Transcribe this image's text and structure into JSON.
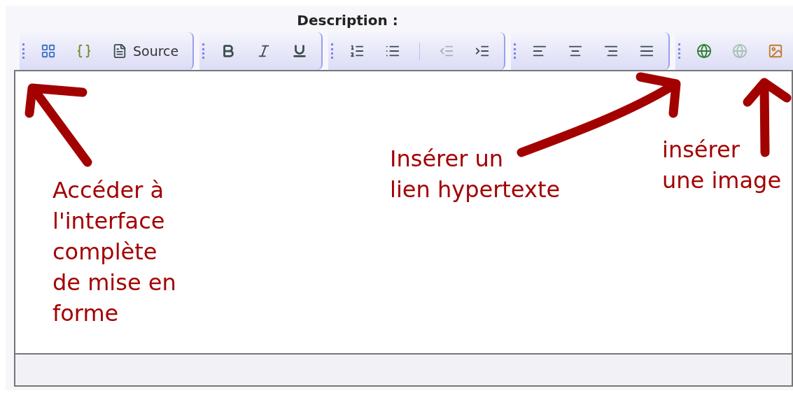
{
  "field_label": "Description :",
  "toolbar": [
    {
      "buttons": [
        {
          "kind": "maximize",
          "disabled": false
        },
        {
          "kind": "templates",
          "disabled": false
        },
        {
          "kind": "source",
          "label": "Source",
          "disabled": false
        }
      ]
    },
    {
      "buttons": [
        {
          "kind": "bold",
          "disabled": false
        },
        {
          "kind": "italic",
          "disabled": false
        },
        {
          "kind": "underline",
          "disabled": false
        }
      ]
    },
    {
      "buttons": [
        {
          "kind": "ordered-list",
          "disabled": false
        },
        {
          "kind": "bullet-list",
          "disabled": false
        },
        {
          "kind": "separator"
        },
        {
          "kind": "outdent",
          "disabled": true
        },
        {
          "kind": "indent",
          "disabled": false
        }
      ]
    },
    {
      "buttons": [
        {
          "kind": "align-left",
          "disabled": false
        },
        {
          "kind": "align-center",
          "disabled": false
        },
        {
          "kind": "align-right",
          "disabled": false
        },
        {
          "kind": "align-justify",
          "disabled": false
        }
      ]
    },
    {
      "buttons": [
        {
          "kind": "link",
          "disabled": false
        },
        {
          "kind": "unlink",
          "disabled": true
        },
        {
          "kind": "image",
          "disabled": false
        }
      ]
    }
  ],
  "annotations": [
    {
      "lines": [
        "Accéder à",
        "l'interface",
        "complète",
        "de mise en",
        "forme"
      ]
    },
    {
      "lines": [
        "Insérer un",
        "lien hypertexte"
      ]
    },
    {
      "lines": [
        "insérer",
        "une image"
      ]
    }
  ]
}
